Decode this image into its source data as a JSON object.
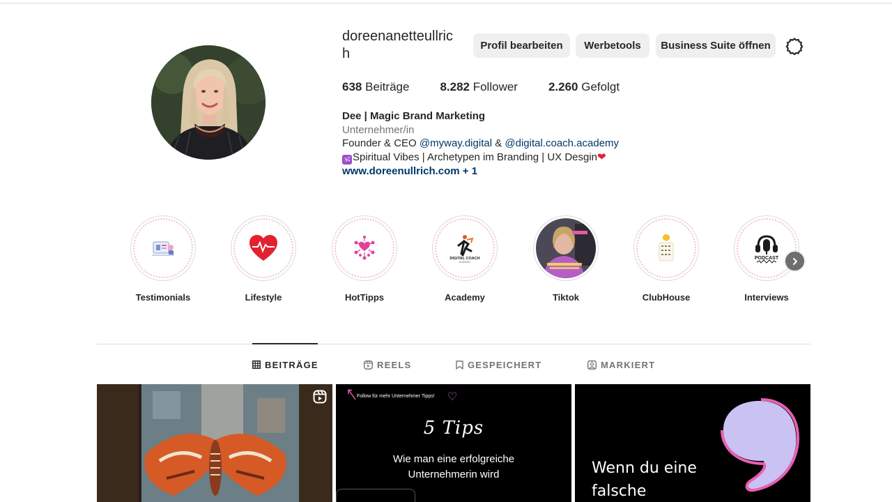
{
  "profile": {
    "username": "doreenanetteullrich",
    "buttons": {
      "edit_profile": "Profil bearbeiten",
      "ad_tools": "Werbetools",
      "business_suite": "Business Suite öffnen"
    },
    "stats": [
      {
        "count": "638",
        "label": "Beiträge"
      },
      {
        "count": "8.282",
        "label": "Follower"
      },
      {
        "count": "2.260",
        "label": "Gefolgt"
      }
    ],
    "bio": {
      "name": "Dee | Magic Brand Marketing",
      "category": "Unternehmer/in",
      "line1_prefix": "Founder & CEO ",
      "mention1": "@myway.digital",
      "line1_mid": " & ",
      "mention2": "@digital.coach.academy",
      "line2_symbol": "🕉",
      "line2": "Spiritual Vibes | Archetypen im Branding | UX Desgin",
      "line2_heart": "❤",
      "link": "www.doreenullrich.com + 1"
    }
  },
  "highlights": [
    {
      "label": "Testimonials",
      "icon": "testimonials-icon"
    },
    {
      "label": "Lifestyle",
      "icon": "heart-icon"
    },
    {
      "label": "HotTipps",
      "icon": "hearts-burst-icon"
    },
    {
      "label": "Academy",
      "icon": "digital-coach-logo"
    },
    {
      "label": "Tiktok",
      "icon": "portrait-photo"
    },
    {
      "label": "ClubHouse",
      "icon": "clubhouse-icon"
    },
    {
      "label": "Interviews",
      "icon": "podcast-microphone-icon"
    }
  ],
  "tabs": [
    {
      "label": "BEITRÄGE",
      "icon": "grid-icon",
      "active": true
    },
    {
      "label": "REELS",
      "icon": "reels-icon",
      "active": false
    },
    {
      "label": "GESPEICHERT",
      "icon": "bookmark-icon",
      "active": false
    },
    {
      "label": "MARKIERT",
      "icon": "tagged-icon",
      "active": false
    }
  ],
  "posts": {
    "post2": {
      "top_text": "Follow für mehr Unternehmer Tipps!",
      "script_title": "5 Tips",
      "line1": "Wie man eine erfolgreiche",
      "line2": "Unternehmerin wird"
    },
    "post3": {
      "line1": "Wenn du eine",
      "line2": "falsche"
    }
  },
  "colors": {
    "link": "#00376b",
    "button_bg": "#efefef",
    "secondary_text": "#737373",
    "highlight_ring_accent": "#f1bfd8"
  }
}
